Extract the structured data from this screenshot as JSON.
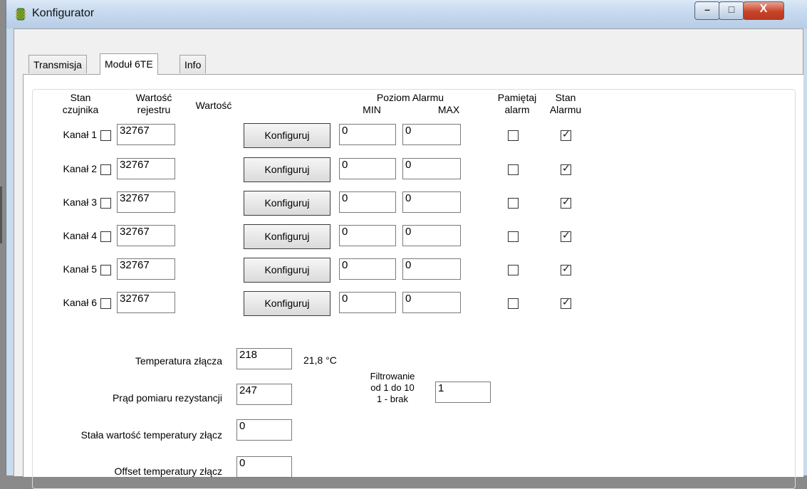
{
  "window": {
    "title": "Konfigurator",
    "controls": {
      "minimize": "–",
      "maximize": "□",
      "close": "X"
    }
  },
  "tabs": [
    {
      "label": "Transmisja",
      "active": false
    },
    {
      "label": "Moduł 6TE",
      "active": true
    },
    {
      "label": "Info",
      "active": false
    }
  ],
  "headers": {
    "stan_czujnika_1": "Stan",
    "stan_czujnika_2": "czujnika",
    "wartosc_rejestru_1": "Wartość",
    "wartosc_rejestru_2": "rejestru",
    "wartosc": "Wartość",
    "poziom_alarmu": "Poziom Alarmu",
    "min": "MIN",
    "max": "MAX",
    "pamietaj_1": "Pamiętaj",
    "pamietaj_2": "alarm",
    "stan_alarmu_1": "Stan",
    "stan_alarmu_2": "Alarmu"
  },
  "channels": [
    {
      "label": "Kanał 1",
      "sensor_checked": false,
      "register": "32767",
      "button": "Konfiguruj",
      "min": "0",
      "max": "0",
      "remember": false,
      "alarm": true
    },
    {
      "label": "Kanał 2",
      "sensor_checked": false,
      "register": "32767",
      "button": "Konfiguruj",
      "min": "0",
      "max": "0",
      "remember": false,
      "alarm": true
    },
    {
      "label": "Kanał 3",
      "sensor_checked": false,
      "register": "32767",
      "button": "Konfiguruj",
      "min": "0",
      "max": "0",
      "remember": false,
      "alarm": true
    },
    {
      "label": "Kanał 4",
      "sensor_checked": false,
      "register": "32767",
      "button": "Konfiguruj",
      "min": "0",
      "max": "0",
      "remember": false,
      "alarm": true
    },
    {
      "label": "Kanał 5",
      "sensor_checked": false,
      "register": "32767",
      "button": "Konfiguruj",
      "min": "0",
      "max": "0",
      "remember": false,
      "alarm": true
    },
    {
      "label": "Kanał 6",
      "sensor_checked": false,
      "register": "32767",
      "button": "Konfiguruj",
      "min": "0",
      "max": "0",
      "remember": false,
      "alarm": true
    }
  ],
  "bottom": {
    "temperatura_label": "Temperatura złącza",
    "temperatura_value": "218",
    "temperatura_readout": "21,8 °C",
    "prad_label": "Prąd pomiaru rezystancji",
    "prad_value": "247",
    "stala_label": "Stała wartość temperatury złącz",
    "stala_value": "0",
    "offset_label": "Offset temperatury złącz",
    "offset_value": "0",
    "filtr_1": "Filtrowanie",
    "filtr_2": "od 1 do 10",
    "filtr_3": "1 - brak",
    "filtr_value": "1"
  }
}
